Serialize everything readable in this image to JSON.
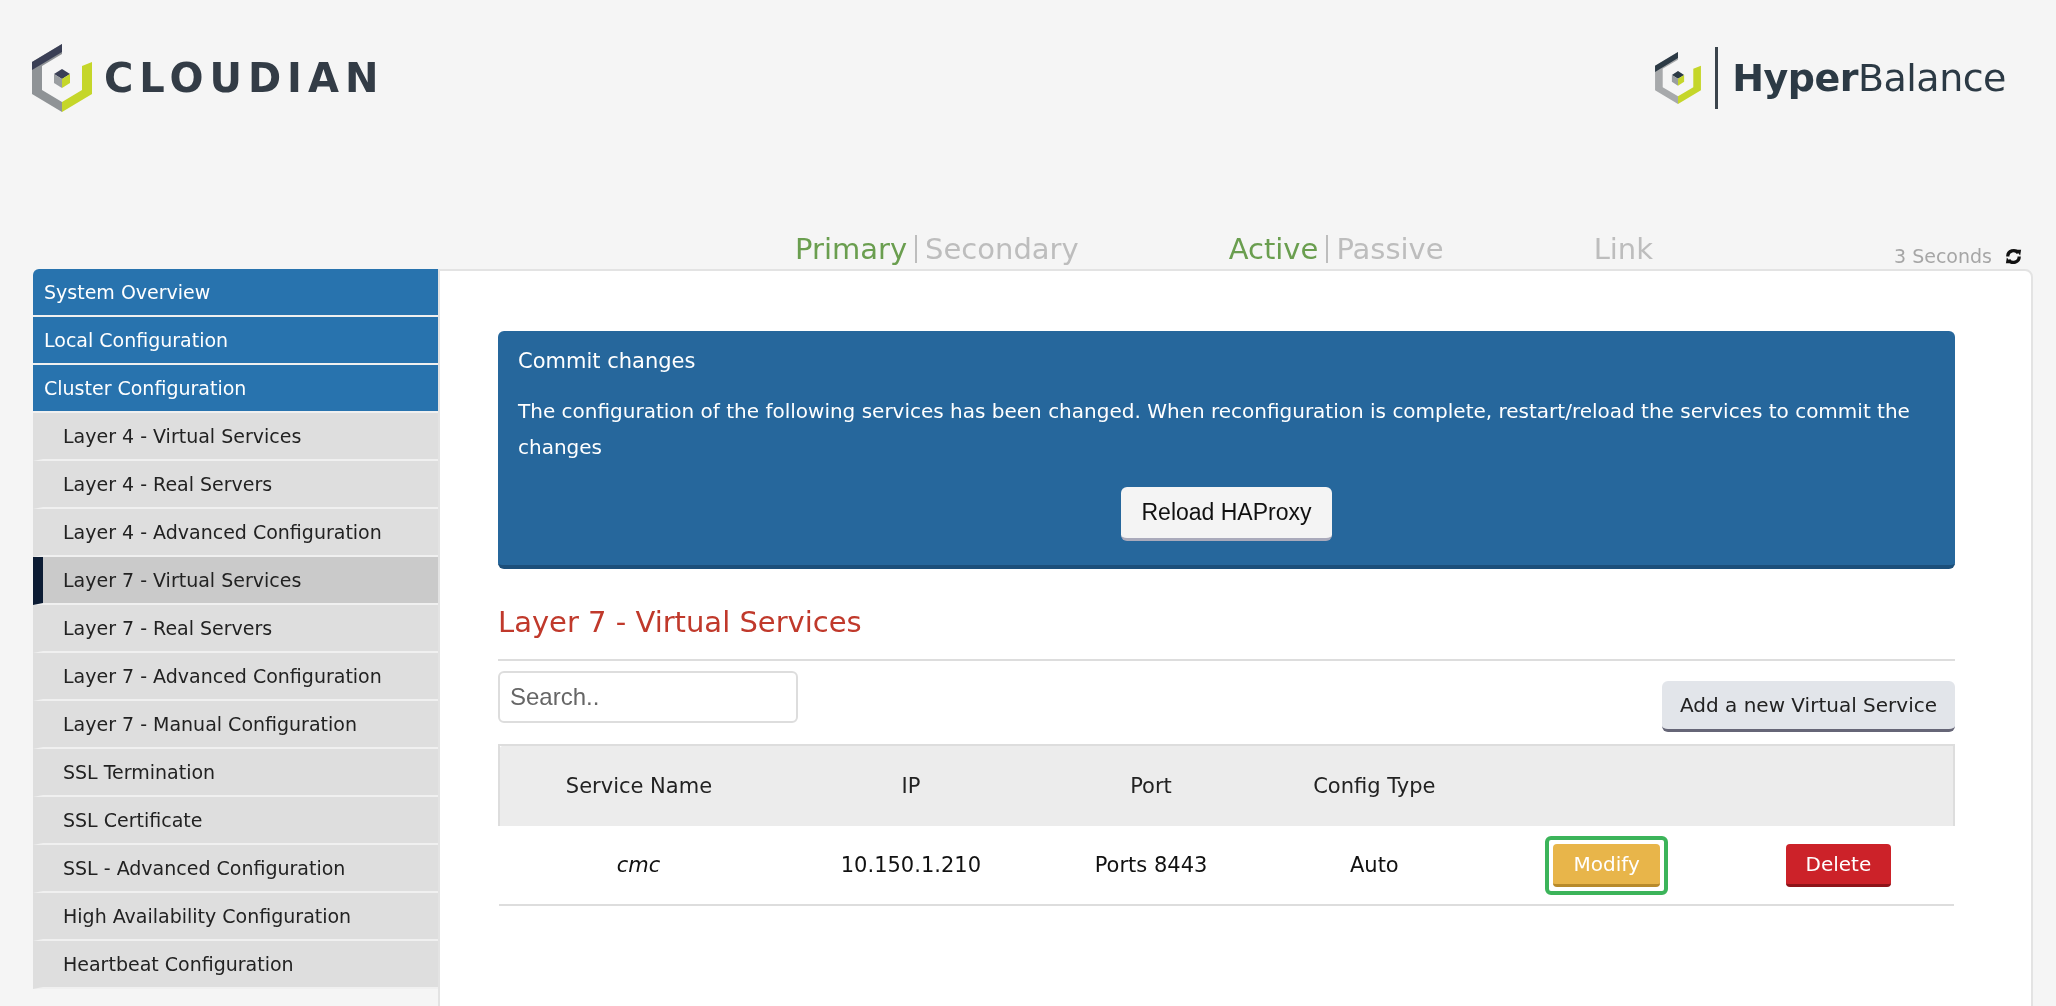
{
  "header": {
    "brand": "CLOUDIAN",
    "product": {
      "bold": "Hyper",
      "regular": "Balance"
    }
  },
  "status_groups": [
    {
      "options": [
        {
          "label": "Primary",
          "selected": true
        },
        {
          "label": "Secondary",
          "selected": false
        }
      ]
    },
    {
      "options": [
        {
          "label": "Active",
          "selected": true
        },
        {
          "label": "Passive",
          "selected": false
        }
      ]
    },
    {
      "options": [
        {
          "label": "Link",
          "selected": false
        }
      ]
    }
  ],
  "refresh": {
    "label": "3 Seconds"
  },
  "sidebar": {
    "items": [
      {
        "label": "System Overview",
        "kind": "section",
        "selected": false
      },
      {
        "label": "Local Configuration",
        "kind": "section",
        "selected": false
      },
      {
        "label": "Cluster Configuration",
        "kind": "section",
        "selected": false
      },
      {
        "label": "Layer 4 - Virtual Services",
        "kind": "sub",
        "selected": false
      },
      {
        "label": "Layer 4 - Real Servers",
        "kind": "sub",
        "selected": false
      },
      {
        "label": "Layer 4 - Advanced Configuration",
        "kind": "sub",
        "selected": false
      },
      {
        "label": "Layer 7 - Virtual Services",
        "kind": "sub",
        "selected": true
      },
      {
        "label": "Layer 7 - Real Servers",
        "kind": "sub",
        "selected": false
      },
      {
        "label": "Layer 7 - Advanced Configuration",
        "kind": "sub",
        "selected": false
      },
      {
        "label": "Layer 7 - Manual Configuration",
        "kind": "sub",
        "selected": false
      },
      {
        "label": "SSL Termination",
        "kind": "sub",
        "selected": false
      },
      {
        "label": "SSL Certificate",
        "kind": "sub",
        "selected": false
      },
      {
        "label": "SSL - Advanced Configuration",
        "kind": "sub",
        "selected": false
      },
      {
        "label": "High Availability Configuration",
        "kind": "sub",
        "selected": false
      },
      {
        "label": "Heartbeat Configuration",
        "kind": "sub",
        "selected": false
      }
    ]
  },
  "commit_panel": {
    "title": "Commit changes",
    "message": "The configuration of the following services has been changed. When reconfiguration is complete, restart/reload the services to commit the changes",
    "button": "Reload HAProxy"
  },
  "page_title": "Layer 7 - Virtual Services",
  "search": {
    "placeholder": "Search.."
  },
  "add_button": "Add a new Virtual Service",
  "table": {
    "columns": [
      "Service Name",
      "IP",
      "Port",
      "Config Type"
    ],
    "rows": [
      {
        "cells": [
          "cmc",
          "10.150.1.210",
          "Ports 8443",
          "Auto"
        ],
        "actions": [
          {
            "label": "Modify",
            "kind": "modify",
            "highlighted": true
          },
          {
            "label": "Delete",
            "kind": "delete",
            "highlighted": false
          }
        ]
      }
    ]
  }
}
